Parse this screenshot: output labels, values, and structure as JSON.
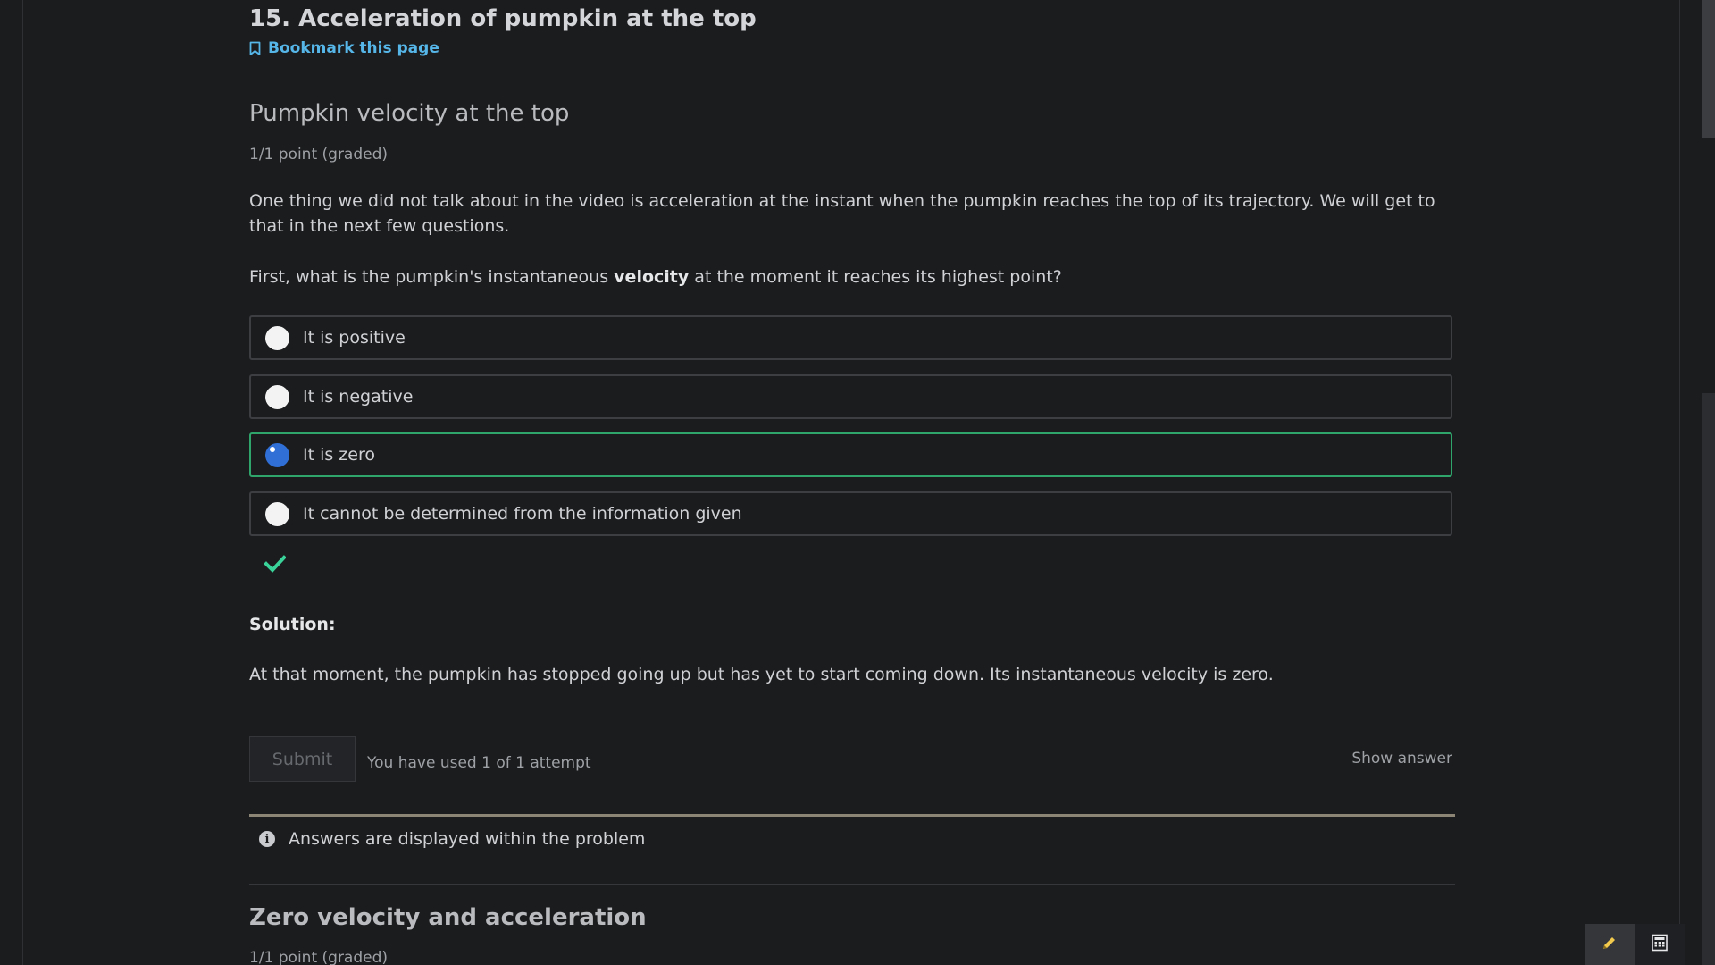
{
  "unit": {
    "title": "15. Acceleration of pumpkin at the top",
    "bookmark_label": "Bookmark this page"
  },
  "problem": {
    "title": "Pumpkin velocity at the top",
    "points": "1/1 point (graded)",
    "intro": "One thing we did not talk about in the video is acceleration at the instant when the pumpkin reaches the top of its trajectory. We will get to that in the next few questions.",
    "question_before": "First, what is the pumpkin's instantaneous ",
    "question_bold": "velocity",
    "question_after": " at the moment it reaches its highest point?",
    "choices": [
      {
        "label": "It is positive",
        "selected": false
      },
      {
        "label": "It is negative",
        "selected": false
      },
      {
        "label": "It is zero",
        "selected": true
      },
      {
        "label": "It cannot be determined from the information given",
        "selected": false
      }
    ],
    "solution_heading": "Solution:",
    "solution_text": "At that moment, the pumpkin has stopped going up but has yet to start coming down. Its instantaneous velocity is zero.",
    "submit_label": "Submit",
    "attempts_text": "You have used 1 of 1 attempt",
    "show_answer_label": "Show answer",
    "notice": "Answers are displayed within the problem"
  },
  "next_problem": {
    "title": "Zero velocity and acceleration",
    "points": "1/1 point (graded)"
  },
  "colors": {
    "background": "#1b1c1e",
    "link": "#56b6e8",
    "correct_border": "#2fa56c",
    "selected_radio": "#2f6fd6",
    "checkmark": "#3ad39a",
    "notes_pencil": "#f2c94c"
  },
  "icons": {
    "bookmark": "bookmark-icon",
    "check": "check-icon",
    "info": "info-icon",
    "notes": "pencil-icon",
    "calculator": "calculator-icon"
  }
}
